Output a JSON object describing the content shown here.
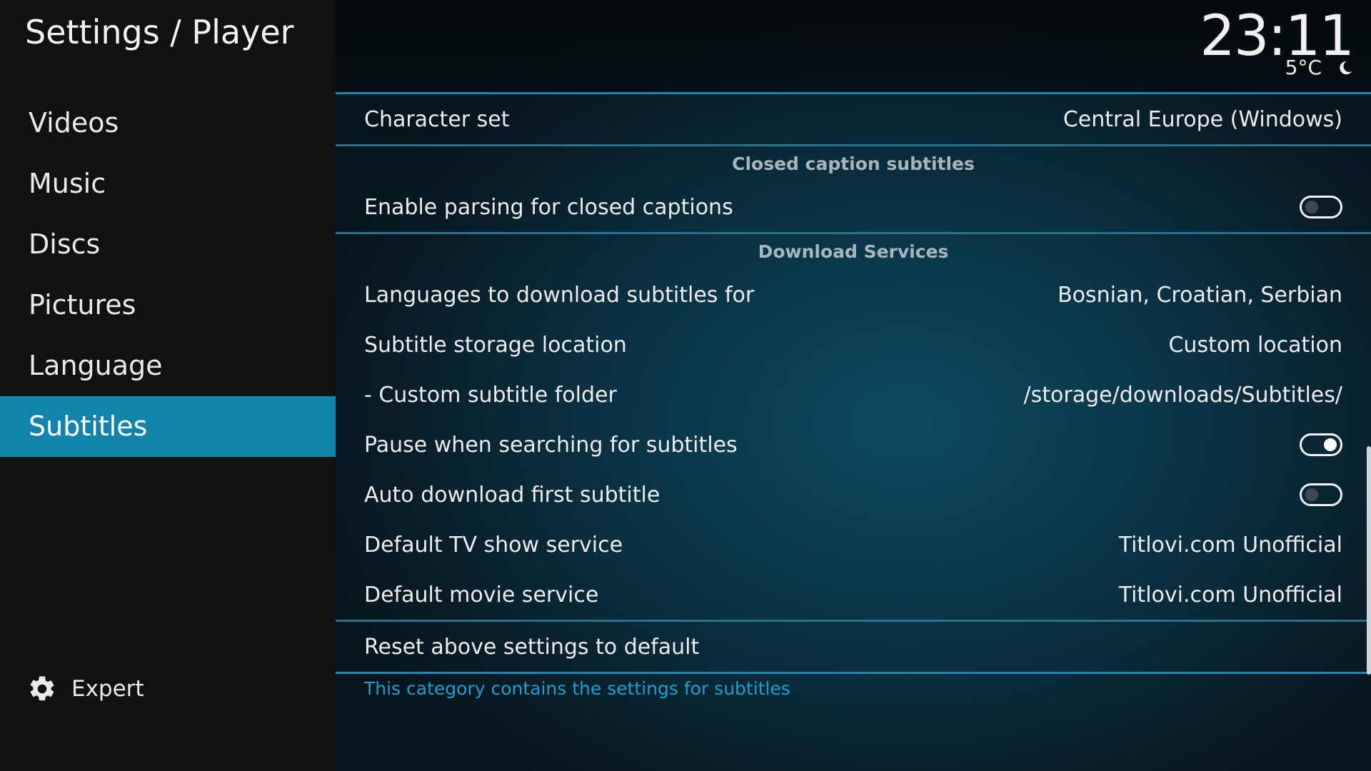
{
  "header": {
    "title": "Settings / Player",
    "clock": "23:11",
    "temperature": "5°C",
    "weather_icon": "moon-icon"
  },
  "sidebar": {
    "items": [
      {
        "label": "Videos"
      },
      {
        "label": "Music"
      },
      {
        "label": "Discs"
      },
      {
        "label": "Pictures"
      },
      {
        "label": "Language"
      },
      {
        "label": "Subtitles"
      }
    ],
    "active_index": 5,
    "expert_label": "Expert",
    "expert_icon": "gear-icon"
  },
  "settings": {
    "character_set": {
      "label": "Character set",
      "value": "Central Europe (Windows)"
    },
    "group_closed_caption": "Closed caption subtitles",
    "enable_parsing": {
      "label": "Enable parsing for closed captions",
      "state": "off"
    },
    "group_download": "Download Services",
    "languages": {
      "label": "Languages to download subtitles for",
      "value": "Bosnian, Croatian, Serbian"
    },
    "storage_location": {
      "label": "Subtitle storage location",
      "value": "Custom location"
    },
    "custom_folder": {
      "label": "- Custom subtitle folder",
      "value": "/storage/downloads/Subtitles/"
    },
    "pause_searching": {
      "label": "Pause when searching for subtitles",
      "state": "on"
    },
    "auto_download": {
      "label": "Auto download first subtitle",
      "state": "off"
    },
    "tv_service": {
      "label": "Default TV show service",
      "value": "Titlovi.com Unofficial"
    },
    "movie_service": {
      "label": "Default movie service",
      "value": "Titlovi.com Unofficial"
    },
    "reset": {
      "label": "Reset above settings to default"
    }
  },
  "description": "This category contains the settings for subtitles",
  "colors": {
    "accent": "#1284ab",
    "description_text": "#1e9fd0",
    "sidebar_bg": "#101112"
  }
}
